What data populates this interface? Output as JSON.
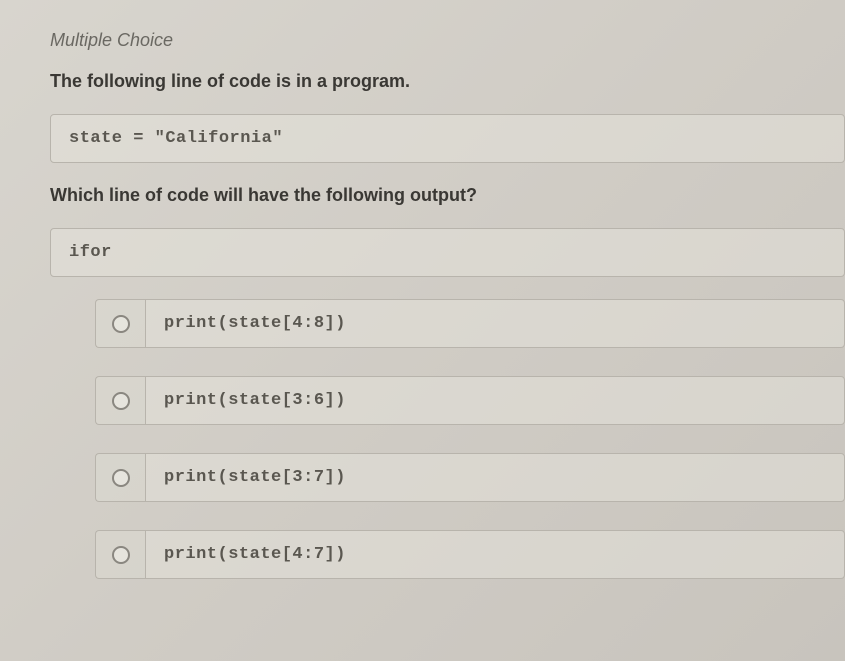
{
  "question": {
    "type": "Multiple Choice",
    "prompt1": "The following line of code is in a program.",
    "code": "state = \"California\"",
    "prompt2": "Which line of code will have the following output?",
    "output": "ifor"
  },
  "options": [
    {
      "code": "print(state[4:8])"
    },
    {
      "code": "print(state[3:6])"
    },
    {
      "code": "print(state[3:7])"
    },
    {
      "code": "print(state[4:7])"
    }
  ]
}
